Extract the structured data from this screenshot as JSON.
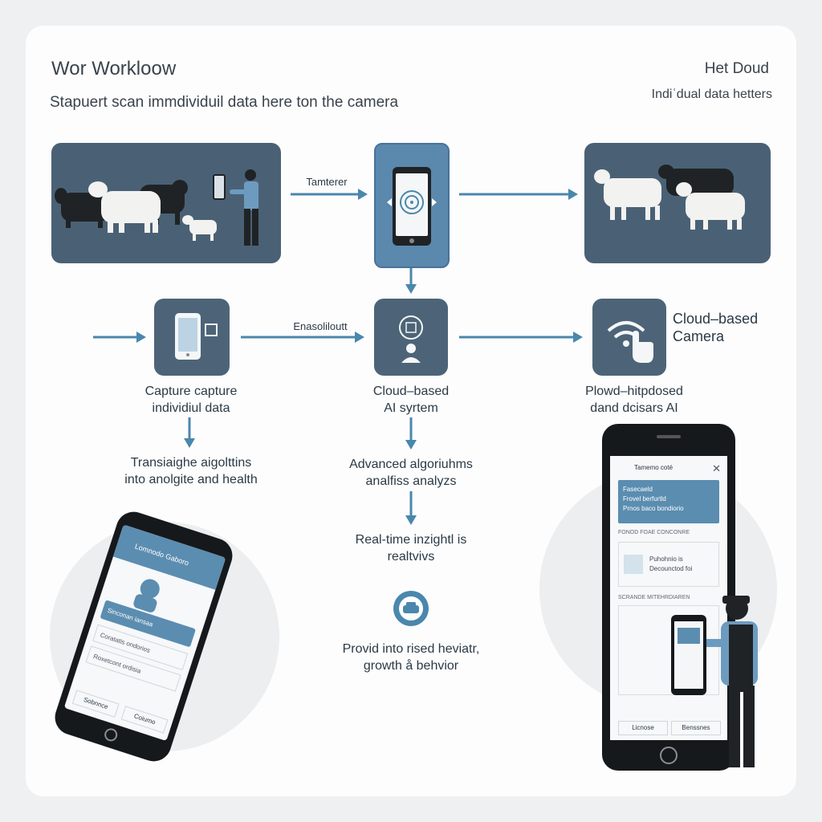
{
  "header": {
    "title": "Wor Workloow",
    "subtitle": "Stapuert scan immdividuil data here ton the camera",
    "right_title": "Het Doud",
    "right_subtitle": "Indiʿdual data hetters"
  },
  "flow": {
    "top_arrow_label": "Tamterer",
    "mid_arrow_label": "Enasoliloutt",
    "step_capture": [
      "Capture capture",
      "individiul data"
    ],
    "step_cloud": [
      "Cloud–based",
      "AI syrtem"
    ],
    "step_camera": [
      "Cloud–based",
      "Camera"
    ],
    "step_camera_caption": [
      "Plowd–hitpdosed",
      "dand dcisars AI"
    ],
    "step_translate": [
      "Transiaighe aigolttins",
      "into anolgite and health"
    ],
    "step_advanced": [
      "Advanced algoriuhms",
      "analfiss analyzs"
    ],
    "step_realtime": [
      "Real-time inzightl is",
      "realtvivs"
    ],
    "step_provide": [
      "Provid into rised heviatr,",
      "growth å behvior"
    ]
  },
  "left_phone": {
    "header_text": "Lomnodo Gaboro",
    "card_title": "Sinconan iansaa",
    "rows": [
      "Coratatis ondorios",
      "Roxetcont ordisia"
    ],
    "buttons": [
      "Sobnnce",
      "Coiumo"
    ]
  },
  "right_phone": {
    "header_text": "Tamemo coté",
    "card_title": "Fasecaeld",
    "card_line1": "Frovel berfurtld",
    "card_line2": "Prnos baco bondiorio",
    "section1": "FONOD FOAE CONCONRE",
    "item_line1": "Puhohnio is",
    "item_line2": "Decounctod foi",
    "section2": "SCRANDE MITEHRDIAREN",
    "buttons": [
      "Licnose",
      "Benssnes"
    ]
  },
  "colors": {
    "panel": "#4a6175",
    "accent": "#4a87ad",
    "phone_tile": "#5b88ad",
    "text": "#2b3a47"
  }
}
